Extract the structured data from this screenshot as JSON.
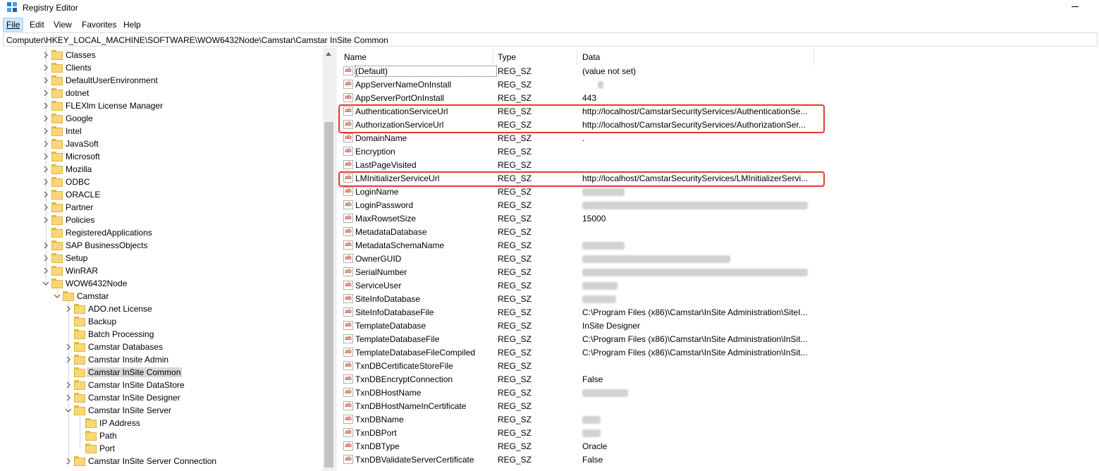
{
  "window": {
    "title": "Registry Editor"
  },
  "menu": [
    {
      "label": "File",
      "active": true
    },
    {
      "label": "Edit"
    },
    {
      "label": "View"
    },
    {
      "label": "Favorites"
    },
    {
      "label": "Help"
    }
  ],
  "address": "Computer\\HKEY_LOCAL_MACHINE\\SOFTWARE\\WOW6432Node\\Camstar\\Camstar InSite Common",
  "tree": [
    {
      "label": "Classes",
      "level": 0,
      "state": "collapsed"
    },
    {
      "label": "Clients",
      "level": 0,
      "state": "collapsed"
    },
    {
      "label": "DefaultUserEnvironment",
      "level": 0,
      "state": "collapsed"
    },
    {
      "label": "dotnet",
      "level": 0,
      "state": "collapsed"
    },
    {
      "label": "FLEXlm License Manager",
      "level": 0,
      "state": "collapsed"
    },
    {
      "label": "Google",
      "level": 0,
      "state": "collapsed"
    },
    {
      "label": "Intel",
      "level": 0,
      "state": "collapsed"
    },
    {
      "label": "JavaSoft",
      "level": 0,
      "state": "collapsed"
    },
    {
      "label": "Microsoft",
      "level": 0,
      "state": "collapsed"
    },
    {
      "label": "Mozilla",
      "level": 0,
      "state": "collapsed"
    },
    {
      "label": "ODBC",
      "level": 0,
      "state": "collapsed"
    },
    {
      "label": "ORACLE",
      "level": 0,
      "state": "collapsed"
    },
    {
      "label": "Partner",
      "level": 0,
      "state": "collapsed"
    },
    {
      "label": "Policies",
      "level": 0,
      "state": "collapsed"
    },
    {
      "label": "RegisteredApplications",
      "level": 0,
      "state": "none"
    },
    {
      "label": "SAP BusinessObjects",
      "level": 0,
      "state": "collapsed"
    },
    {
      "label": "Setup",
      "level": 0,
      "state": "collapsed"
    },
    {
      "label": "WinRAR",
      "level": 0,
      "state": "collapsed"
    },
    {
      "label": "WOW6432Node",
      "level": 0,
      "state": "expanded"
    },
    {
      "label": "Camstar",
      "level": 1,
      "state": "expanded"
    },
    {
      "label": "ADO.net License",
      "level": 2,
      "state": "collapsed"
    },
    {
      "label": "Backup",
      "level": 2,
      "state": "none"
    },
    {
      "label": "Batch Processing",
      "level": 2,
      "state": "none"
    },
    {
      "label": "Camstar Databases",
      "level": 2,
      "state": "collapsed"
    },
    {
      "label": "Camstar Insite Admin",
      "level": 2,
      "state": "collapsed"
    },
    {
      "label": "Camstar InSite Common",
      "level": 2,
      "state": "none",
      "selected": true
    },
    {
      "label": "Camstar InSite DataStore",
      "level": 2,
      "state": "collapsed"
    },
    {
      "label": "Camstar InSite Designer",
      "level": 2,
      "state": "collapsed"
    },
    {
      "label": "Camstar InSite Server",
      "level": 2,
      "state": "expanded"
    },
    {
      "label": "IP Address",
      "level": 3,
      "state": "none"
    },
    {
      "label": "Path",
      "level": 3,
      "state": "none"
    },
    {
      "label": "Port",
      "level": 3,
      "state": "none"
    },
    {
      "label": "Camstar InSite Server Connection",
      "level": 2,
      "state": "collapsed"
    }
  ],
  "columns": {
    "name": "Name",
    "type": "Type",
    "data": "Data"
  },
  "values": [
    {
      "name": "(Default)",
      "type": "REG_SZ",
      "data": "(value not set)"
    },
    {
      "name": "AppServerNameOnInstall",
      "type": "REG_SZ",
      "data": "",
      "redacted": [
        22,
        30
      ]
    },
    {
      "name": "AppServerPortOnInstall",
      "type": "REG_SZ",
      "data": "443"
    },
    {
      "name": "AuthenticationServiceUrl",
      "type": "REG_SZ",
      "data": "http://localhost/CamstarSecurityServices/AuthenticationSe..."
    },
    {
      "name": "AuthorizationServiceUrl",
      "type": "REG_SZ",
      "data": "http://localhost/CamstarSecurityServices/AuthorizationSer..."
    },
    {
      "name": "DomainName",
      "type": "REG_SZ",
      "data": "."
    },
    {
      "name": "Encryption",
      "type": "REG_SZ",
      "data": ""
    },
    {
      "name": "LastPageVisited",
      "type": "REG_SZ",
      "data": ""
    },
    {
      "name": "LMInitializerServiceUrl",
      "type": "REG_SZ",
      "data": "http://localhost/CamstarSecurityServices/LMInitializerServi..."
    },
    {
      "name": "LoginName",
      "type": "REG_SZ",
      "data": "",
      "redacted": [
        0,
        60
      ]
    },
    {
      "name": "LoginPassword",
      "type": "REG_SZ",
      "data": "",
      "redacted": [
        0,
        320
      ]
    },
    {
      "name": "MaxRowsetSize",
      "type": "REG_SZ",
      "data": "15000"
    },
    {
      "name": "MetadataDatabase",
      "type": "REG_SZ",
      "data": ""
    },
    {
      "name": "MetadataSchemaName",
      "type": "REG_SZ",
      "data": "",
      "redacted": [
        0,
        60
      ]
    },
    {
      "name": "OwnerGUID",
      "type": "REG_SZ",
      "data": "",
      "redacted": [
        0,
        210
      ]
    },
    {
      "name": "SerialNumber",
      "type": "REG_SZ",
      "data": "",
      "redacted": [
        0,
        320
      ]
    },
    {
      "name": "ServiceUser",
      "type": "REG_SZ",
      "data": "",
      "redacted": [
        0,
        50
      ]
    },
    {
      "name": "SiteInfoDatabase",
      "type": "REG_SZ",
      "data": "",
      "redacted": [
        0,
        48
      ]
    },
    {
      "name": "SiteInfoDatabaseFile",
      "type": "REG_SZ",
      "data": "C:\\Program Files (x86)\\Camstar\\InSite Administration\\SiteI..."
    },
    {
      "name": "TemplateDatabase",
      "type": "REG_SZ",
      "data": "InSite Designer"
    },
    {
      "name": "TemplateDatabaseFile",
      "type": "REG_SZ",
      "data": "C:\\Program Files (x86)\\Camstar\\InSite Administration\\InSit..."
    },
    {
      "name": "TemplateDatabaseFileCompiled",
      "type": "REG_SZ",
      "data": "C:\\Program Files (x86)\\Camstar\\InSite Administration\\InSit..."
    },
    {
      "name": "TxnDBCertificateStoreFile",
      "type": "REG_SZ",
      "data": ""
    },
    {
      "name": "TxnDBEncryptConnection",
      "type": "REG_SZ",
      "data": "False"
    },
    {
      "name": "TxnDBHostName",
      "type": "REG_SZ",
      "data": "",
      "redacted": [
        0,
        65
      ]
    },
    {
      "name": "TxnDBHostNameInCertificate",
      "type": "REG_SZ",
      "data": ""
    },
    {
      "name": "TxnDBName",
      "type": "REG_SZ",
      "data": "",
      "redacted": [
        0,
        26
      ]
    },
    {
      "name": "TxnDBPort",
      "type": "REG_SZ",
      "data": "",
      "redacted": [
        0,
        26
      ]
    },
    {
      "name": "TxnDBType",
      "type": "REG_SZ",
      "data": "Oracle"
    },
    {
      "name": "TxnDBValidateServerCertificate",
      "type": "REG_SZ",
      "data": "False"
    }
  ],
  "highlighted_values": [
    "AuthenticationServiceUrl",
    "AuthorizationServiceUrl",
    "LMInitializerServiceUrl"
  ],
  "colors": {
    "highlight": "#e53935",
    "folder": "#f8d775",
    "selection": "#cce8ff"
  }
}
